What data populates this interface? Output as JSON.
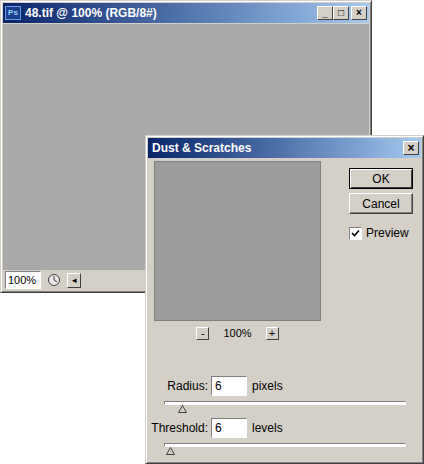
{
  "document_window": {
    "app_icon": "Ps",
    "title": "48.tif @ 100% (RGB/8#)",
    "controls": [
      "_",
      "□",
      "×"
    ],
    "zoom": "100%",
    "scroll_left": "◂"
  },
  "dialog": {
    "title": "Dust & Scratches",
    "close": "×",
    "buttons": [
      {
        "label": "OK",
        "default": true
      },
      {
        "label": "Cancel",
        "default": false
      }
    ],
    "preview": {
      "label": "Preview",
      "checked": true
    },
    "zoom": {
      "minus": "-",
      "value": "100%",
      "plus": "+"
    },
    "fields": [
      {
        "label": "Radius:",
        "value": "6",
        "unit": "pixels",
        "level": 0.07
      },
      {
        "label": "Threshold:",
        "value": "6",
        "unit": "levels",
        "level": 0.02
      }
    ]
  }
}
